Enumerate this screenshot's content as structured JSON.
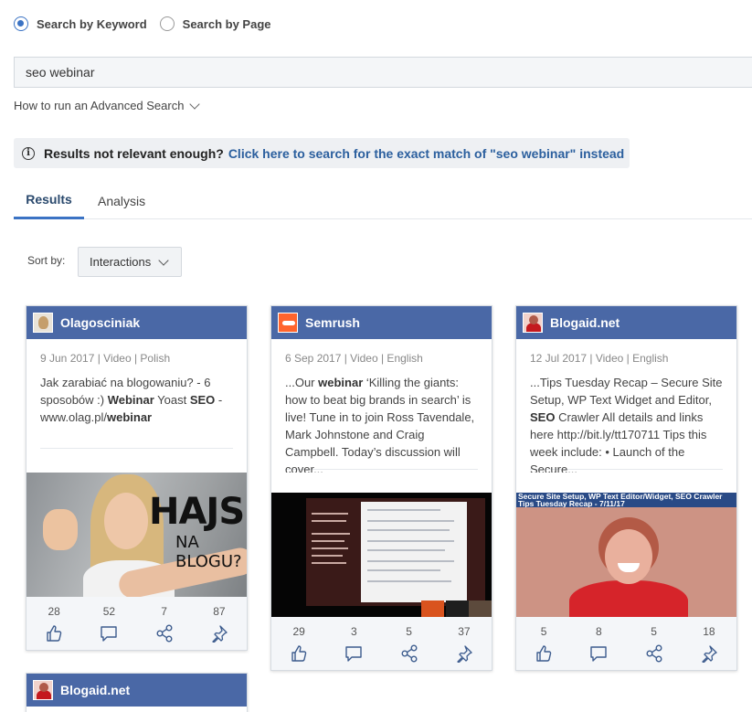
{
  "search_mode": {
    "options": [
      {
        "label": "Search by Keyword",
        "selected": true
      },
      {
        "label": "Search by Page",
        "selected": false
      }
    ]
  },
  "search": {
    "value": "seo webinar"
  },
  "advanced_link": "How to run an Advanced Search",
  "notice": {
    "text": "Results not relevant enough?",
    "link": "Click here to search for the exact match of \"seo webinar\" instead"
  },
  "tabs": [
    {
      "label": "Results",
      "active": true
    },
    {
      "label": "Analysis",
      "active": false
    }
  ],
  "sort": {
    "label": "Sort by:",
    "value": "Interactions"
  },
  "accent_color": "#3b73c4",
  "card_header_color": "#4a68a6",
  "cards": [
    {
      "source": "Olagosciniak",
      "meta": "9 Jun 2017 | Video | Polish",
      "text_parts": [
        {
          "t": "Jak zarabiać na blogowaniu? - 6 sposobów :) ",
          "b": false
        },
        {
          "t": "Webinar",
          "b": true
        },
        {
          "t": " Yoast ",
          "b": false
        },
        {
          "t": "SEO",
          "b": true
        },
        {
          "t": " - www.olag.pl/",
          "b": false
        },
        {
          "t": "webinar",
          "b": true
        }
      ],
      "image_text": {
        "line1": "HAJS",
        "line2": "NA BLOGU?"
      },
      "stats": [
        28,
        52,
        7,
        87
      ]
    },
    {
      "source": "Semrush",
      "meta": "6 Sep 2017 | Video | English",
      "text_parts": [
        {
          "t": "...Our ",
          "b": false
        },
        {
          "t": "webinar",
          "b": true
        },
        {
          "t": " ‘Killing the giants: how to beat big brands in search’ is live! Tune in to join Ross Tavendale, Mark Johnstone and Craig Campbell. Today’s discussion will cover...",
          "b": false
        }
      ],
      "stats": [
        29,
        3,
        5,
        37
      ]
    },
    {
      "source": "Blogaid.net",
      "meta": "12 Jul 2017 | Video | English",
      "text_parts": [
        {
          "t": "...Tips Tuesday Recap – Secure Site Setup, WP Text Widget and Editor, ",
          "b": false
        },
        {
          "t": "SEO",
          "b": true
        },
        {
          "t": " Crawler All details and links here http://bit.ly/tt170711 Tips this week include: • Launch of the Secure...",
          "b": false
        }
      ],
      "image_text": {
        "banner": "Secure Site Setup, WP Text Editor/Widget, SEO Crawler Tips Tuesday Recap - 7/11/17"
      },
      "stats": [
        5,
        8,
        5,
        18
      ]
    },
    {
      "source": "Blogaid.net"
    }
  ],
  "stat_icons": [
    "thumbs-up-icon",
    "comment-icon",
    "share-icon",
    "pin-icon"
  ]
}
